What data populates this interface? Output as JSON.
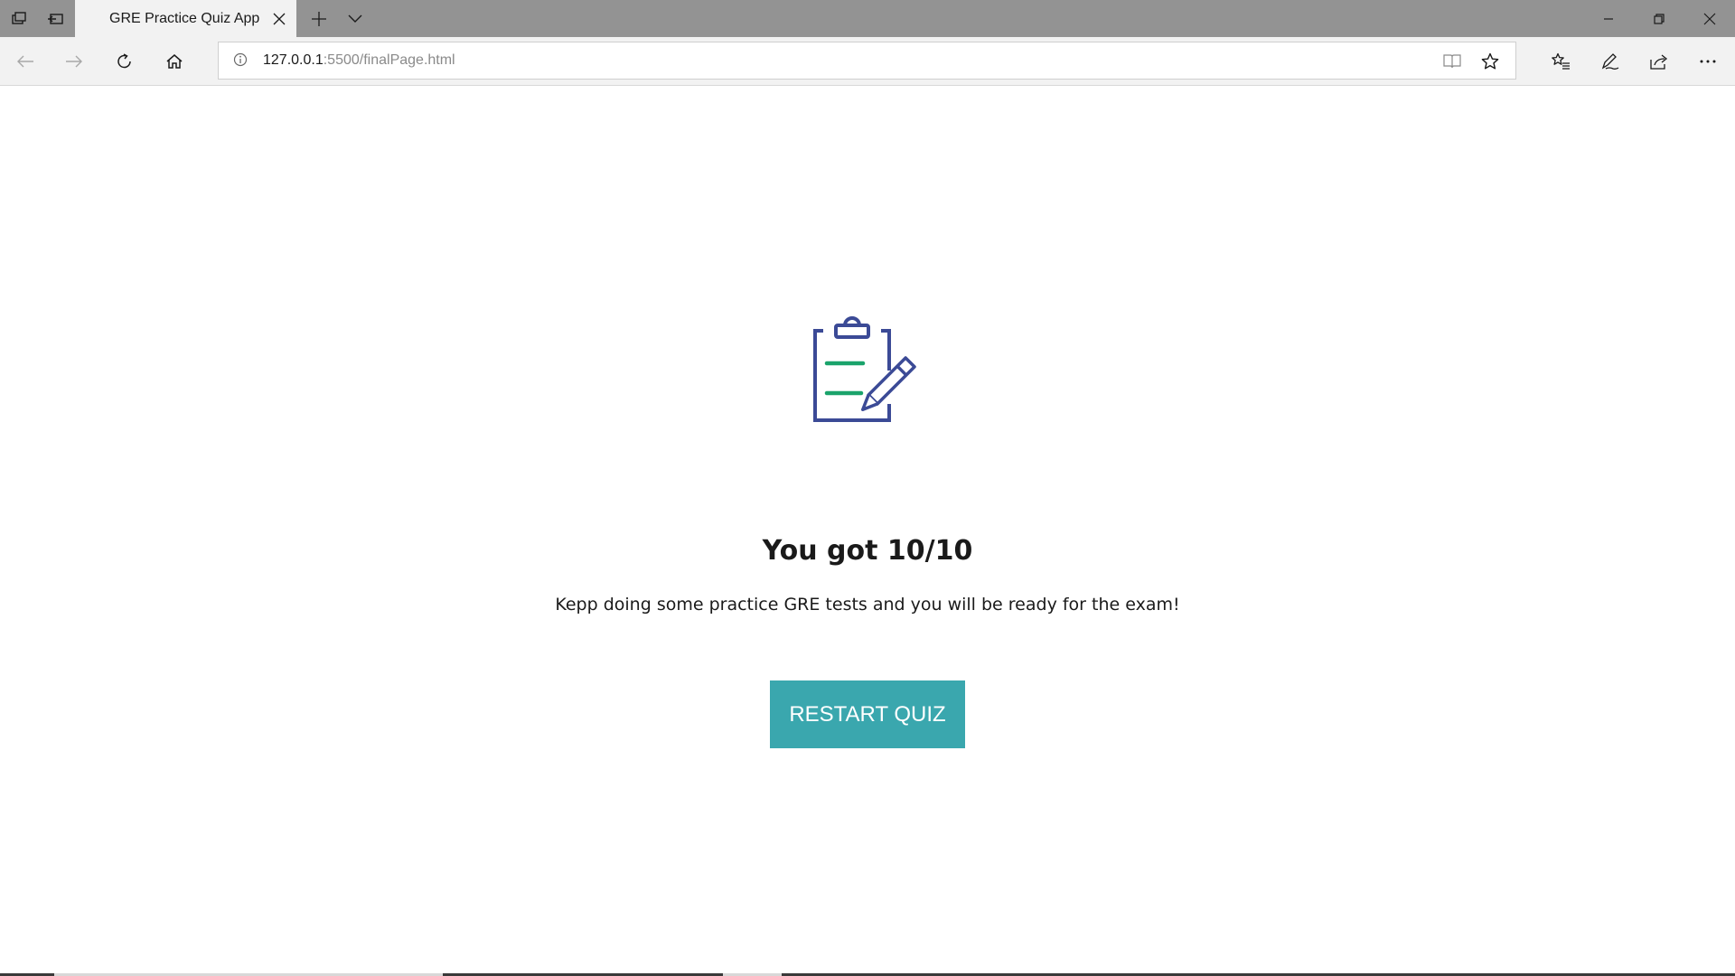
{
  "browser": {
    "tab": {
      "title": "GRE Practice Quiz App"
    },
    "address": {
      "host": "127.0.0.1",
      "path": ":5500/finalPage.html"
    }
  },
  "page": {
    "score_text": "You got 10/10",
    "message": "Kepp doing some practice GRE tests and you will be ready for the exam!",
    "restart_label": "RESTART QUIZ"
  },
  "colors": {
    "button": "#3aa7ae",
    "icon_outline": "#3b4a96",
    "icon_lines": "#1aa36b"
  }
}
